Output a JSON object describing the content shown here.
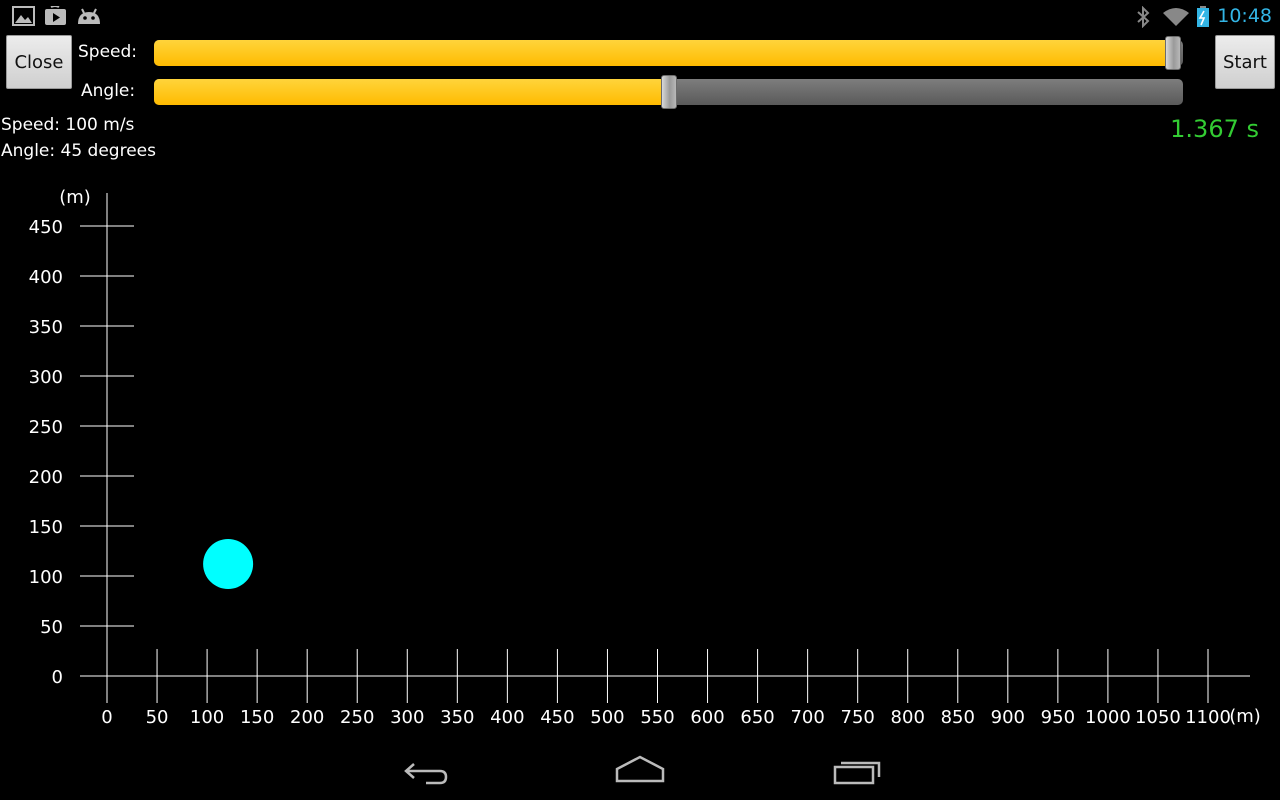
{
  "status": {
    "time": "10:48",
    "icons": [
      "picture-icon",
      "play-store-icon",
      "android-icon",
      "bluetooth-icon",
      "wifi-icon",
      "battery-charging-icon"
    ]
  },
  "controls": {
    "close_label": "Close",
    "start_label": "Start",
    "speed_label": "Speed:",
    "angle_label": "Angle:",
    "speed_fraction": 0.99,
    "angle_fraction": 0.5
  },
  "info": {
    "speed_text": "Speed: 100 m/s",
    "angle_text": "Angle: 45 degrees",
    "elapsed": "1.367 s"
  },
  "colors": {
    "slider_fill": "#ffbb00",
    "timer": "#33cc33",
    "projectile": "#00ffff",
    "clock": "#33b5e5"
  },
  "chart_data": {
    "type": "scatter",
    "xlabel": "(m)",
    "ylabel": "(m)",
    "xlim": [
      0,
      1100
    ],
    "ylim": [
      0,
      450
    ],
    "x_ticks": [
      0,
      50,
      100,
      150,
      200,
      250,
      300,
      350,
      400,
      450,
      500,
      550,
      600,
      650,
      700,
      750,
      800,
      850,
      900,
      950,
      1000,
      1050,
      1100
    ],
    "y_ticks": [
      0,
      50,
      100,
      150,
      200,
      250,
      300,
      350,
      400,
      450
    ],
    "x_tick_labels": [
      "0",
      "50",
      "100",
      "150",
      "200",
      "250",
      "300",
      "350",
      "400",
      "450",
      "500",
      "550",
      "600",
      "650",
      "700",
      "750",
      "800",
      "850",
      "900",
      "950",
      "1000",
      "1050",
      "1100"
    ],
    "y_tick_labels": [
      "0",
      "50",
      "100",
      "150",
      "200",
      "250",
      "300",
      "350",
      "400",
      "450"
    ],
    "points": [
      {
        "x": 121,
        "y": 112
      }
    ]
  },
  "nav": [
    "back-icon",
    "home-icon",
    "recents-icon"
  ]
}
